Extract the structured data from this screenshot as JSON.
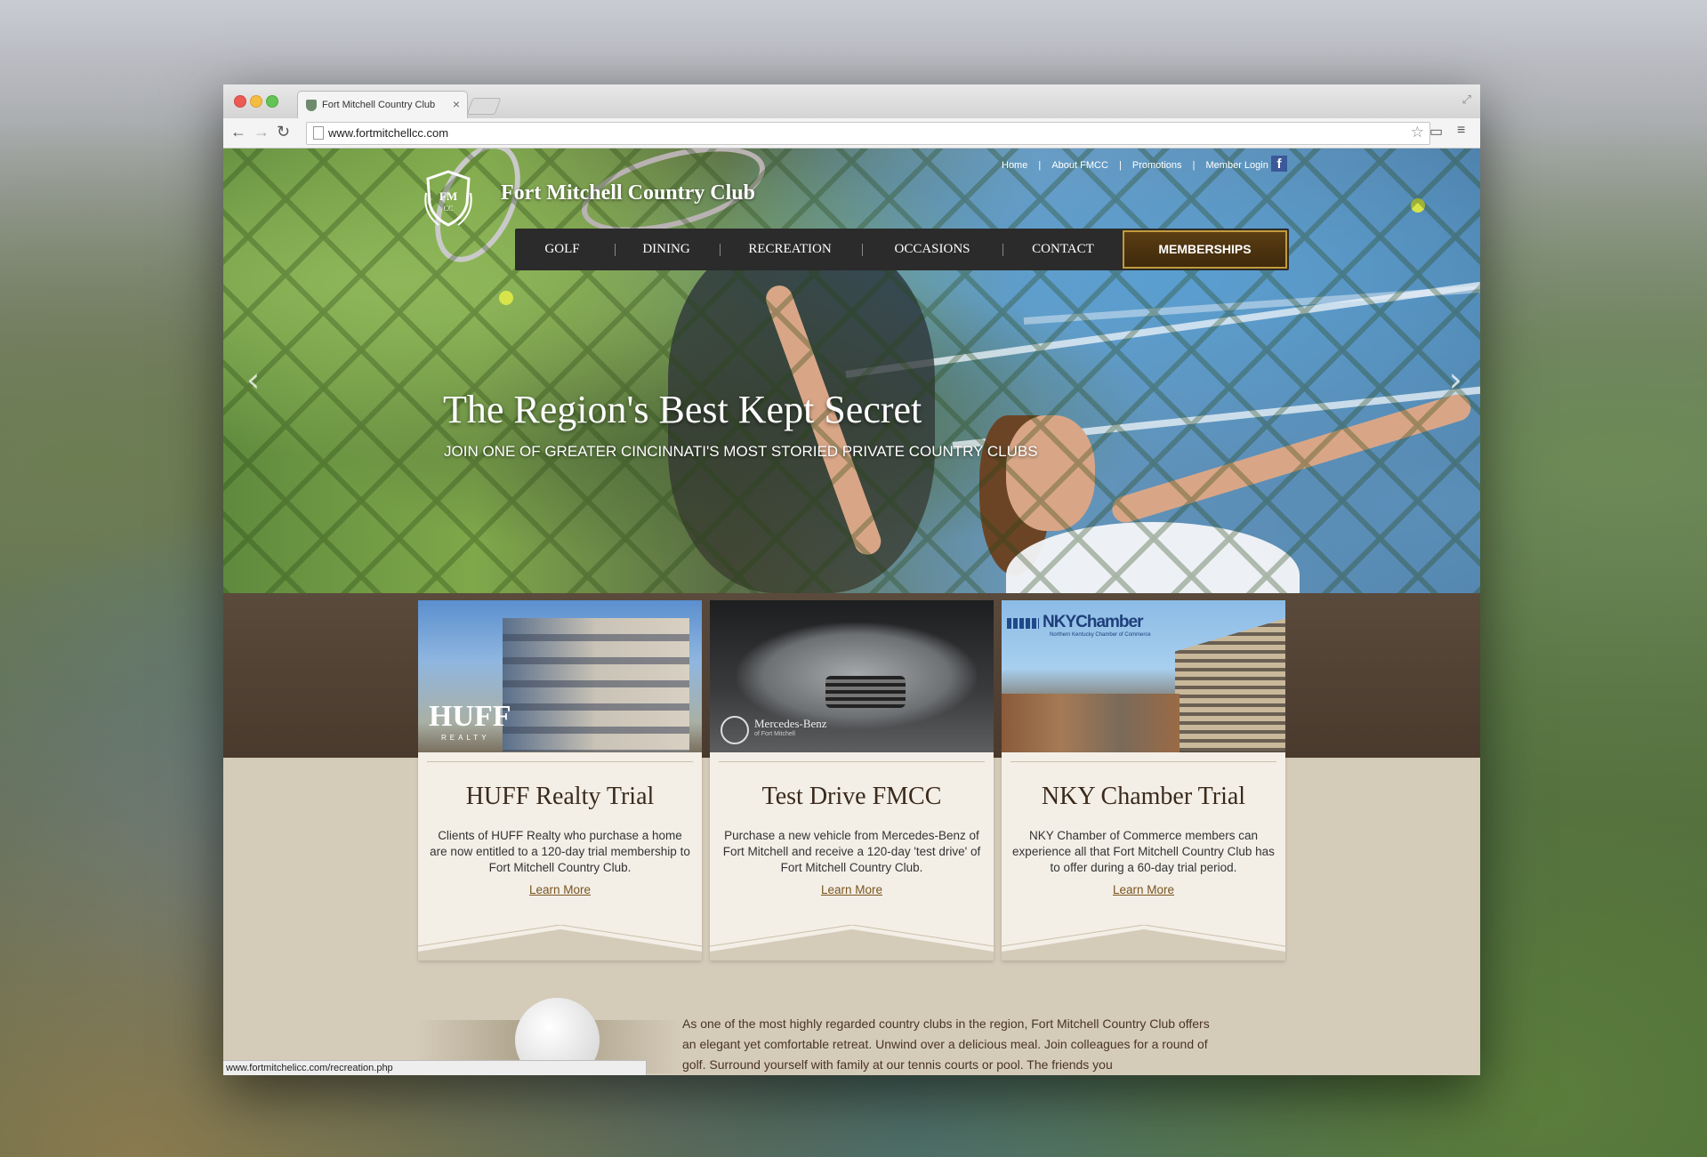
{
  "browser": {
    "tab_title": "Fort Mitchell Country Club",
    "tab_close": "×",
    "url": "www.fortmitchellcc.com",
    "status_url": "www.fortmitchelicc.com/recreation.php"
  },
  "site": {
    "name": "Fort Mitchell Country Club",
    "crest_initials": "FMCC",
    "top_links": [
      "Home",
      "About FMCC",
      "Promotions",
      "Member Login"
    ],
    "top_link_separator": "|",
    "nav": [
      "GOLF",
      "DINING",
      "RECREATION",
      "OCCASIONS",
      "CONTACT"
    ],
    "nav_cta": "MEMBERSHIPS"
  },
  "hero": {
    "headline": "The Region's Best Kept Secret",
    "subline": "JOIN ONE OF GREATER CINCINNATI'S MOST STORIED PRIVATE COUNTRY CLUBS"
  },
  "promos": [
    {
      "title": "HUFF Realty Trial",
      "description": "Clients of HUFF Realty who purchase a home are now entitled to a 120-day trial membership to Fort Mitchell Country Club.",
      "link": "Learn More",
      "image_label": "HUFF",
      "image_sublabel": "REALTY"
    },
    {
      "title": "Test Drive FMCC",
      "description": "Purchase a new vehicle from Mercedes-Benz of Fort Mitchell and receive a 120-day 'test drive' of Fort Mitchell Country Club.",
      "link": "Learn More",
      "image_label": "Mercedes-Benz",
      "image_sublabel": "of Fort Mitchell"
    },
    {
      "title": "NKY Chamber Trial",
      "description": "NKY Chamber of Commerce members can experience all that Fort Mitchell Country Club has to offer during a 60-day trial period.",
      "link": "Learn More",
      "image_label": "NKYChamber",
      "image_sublabel": "Northern Kentucky Chamber of Commerce"
    }
  ],
  "about": "As one of the most highly regarded country clubs in the region, Fort Mitchell Country Club offers an elegant yet comfortable retreat. Unwind over a delicious meal. Join colleagues for a round of golf. Surround yourself with family at our tennis courts or pool. The friends you",
  "colors": {
    "nav_bg": "#2b2b2b",
    "cta_bg": "#4a3210",
    "cta_border": "#c29b3b",
    "band_brown": "#4f3f31",
    "card_bg": "#f3efe7",
    "link_brown": "#7a5420"
  },
  "icons": [
    "back-arrow-icon",
    "forward-arrow-icon",
    "reload-icon",
    "page-icon",
    "star-icon",
    "cast-icon",
    "menu-icon",
    "facebook-icon",
    "chevron-left-icon",
    "chevron-right-icon",
    "crest-icon"
  ]
}
